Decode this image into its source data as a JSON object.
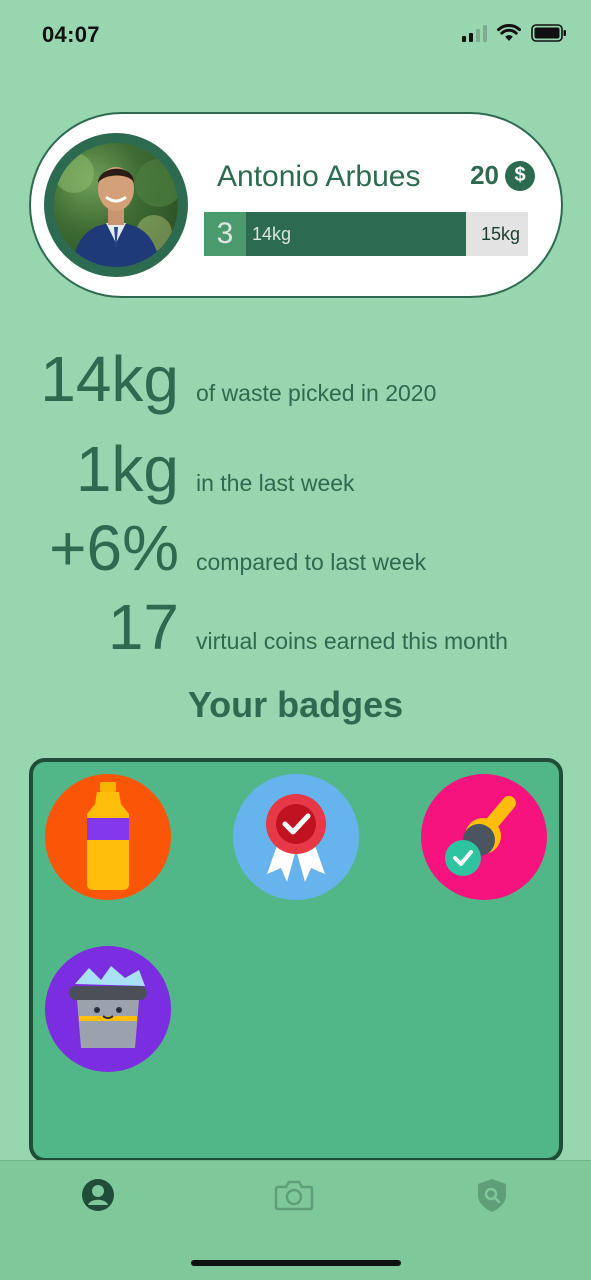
{
  "status_bar": {
    "time": "04:07"
  },
  "profile": {
    "name": "Antonio Arbues",
    "coins": "20",
    "coin_symbol": "$",
    "level": "3",
    "progress_current": "14kg",
    "progress_max": "15kg",
    "progress_fraction": 0.78
  },
  "stats": [
    {
      "value": "14kg",
      "label": "of waste picked in 2020"
    },
    {
      "value": "1kg",
      "label": "in the last week"
    },
    {
      "value": "+6%",
      "label": "compared to last week"
    },
    {
      "value": "17",
      "label": "virtual coins earned this month"
    }
  ],
  "badges_title": "Your badges",
  "badges": [
    {
      "icon": "bottle-icon",
      "color": "#fb5607"
    },
    {
      "icon": "award-ribbon-icon",
      "color": "#66b3ee"
    },
    {
      "icon": "trash-grabber-icon",
      "color": "#f6137e"
    },
    {
      "icon": "full-bin-icon",
      "color": "#7b2ee0"
    }
  ],
  "tabs": [
    {
      "icon": "profile-icon",
      "active": true
    },
    {
      "icon": "camera-icon",
      "active": false
    },
    {
      "icon": "shield-search-icon",
      "active": false
    }
  ],
  "colors": {
    "background": "#98d6b0",
    "primary": "#2c6b4f",
    "badges_box": "#52b788",
    "tab_bar": "#7ec89a"
  }
}
